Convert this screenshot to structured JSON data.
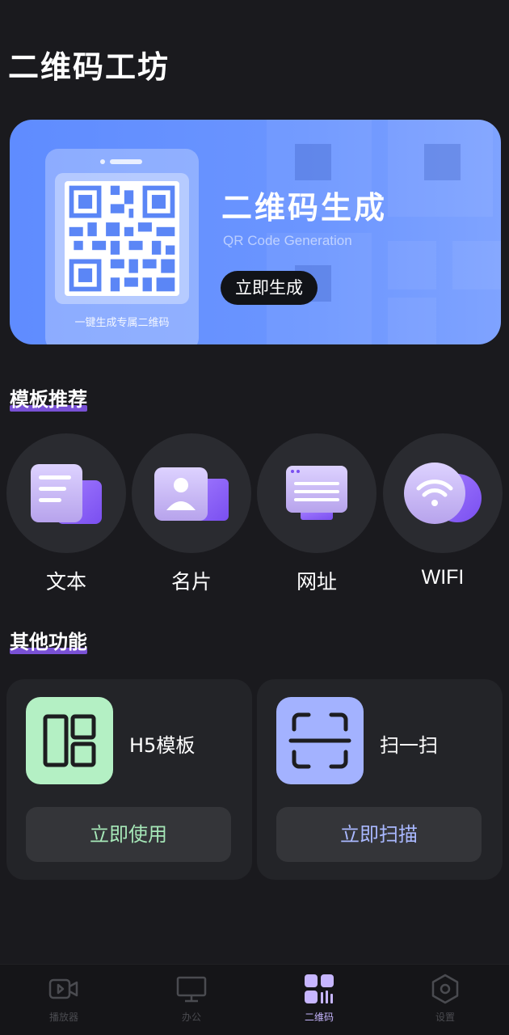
{
  "app": {
    "title": "二维码工坊"
  },
  "banner": {
    "title": "二维码生成",
    "subtitle": "QR Code Generation",
    "button": "立即生成",
    "phone_caption": "一键生成专属二维码",
    "color": "#6b95ff"
  },
  "templates": {
    "heading": "模板推荐",
    "items": [
      {
        "label": "文本",
        "icon": "document-icon"
      },
      {
        "label": "名片",
        "icon": "business-card-icon"
      },
      {
        "label": "网址",
        "icon": "monitor-icon"
      },
      {
        "label": "WIFI",
        "icon": "wifi-icon"
      }
    ]
  },
  "functions": {
    "heading": "其他功能",
    "items": [
      {
        "label": "H5模板",
        "button": "立即使用",
        "icon": "layout-grid-icon",
        "icon_bg": "#b4f0c4",
        "button_color": "#a6e8b8"
      },
      {
        "label": "扫一扫",
        "button": "立即扫描",
        "icon": "scan-icon",
        "icon_bg": "#a3b2ff",
        "button_color": "#a9b8ff"
      }
    ]
  },
  "tabbar": {
    "tabs": [
      {
        "label": "播放器",
        "icon": "video-icon",
        "active": false
      },
      {
        "label": "办公",
        "icon": "monitor-icon",
        "active": false
      },
      {
        "label": "二维码",
        "icon": "qr-grid-icon",
        "active": true
      },
      {
        "label": "设置",
        "icon": "settings-icon",
        "active": false
      }
    ]
  },
  "colors": {
    "background": "#1a1a1e",
    "accent_purple": "#8b5cf6",
    "card": "#232428"
  }
}
